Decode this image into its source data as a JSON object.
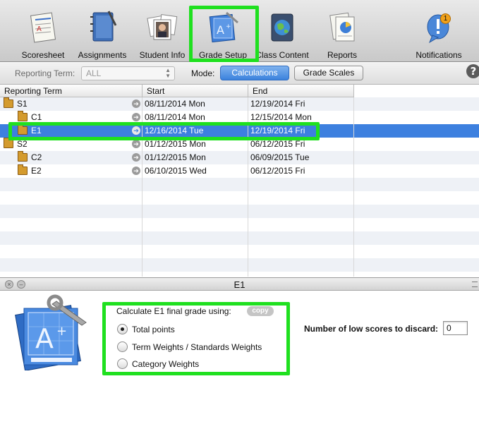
{
  "toolbar": {
    "items": [
      {
        "label": "Scoresheet",
        "icon": "scoresheet-icon"
      },
      {
        "label": "Assignments",
        "icon": "assignments-notebook-icon"
      },
      {
        "label": "Student Info",
        "icon": "student-photos-icon"
      },
      {
        "label": "Grade Setup",
        "icon": "grade-setup-blueprint-icon",
        "highlighted": true
      },
      {
        "label": "Class Content",
        "icon": "globe-icon"
      },
      {
        "label": "Reports",
        "icon": "reports-chart-icon"
      },
      {
        "label": "Notifications",
        "icon": "notifications-icon",
        "badge": "1"
      }
    ]
  },
  "filter": {
    "reporting_term_label": "Reporting Term:",
    "reporting_term_value": "ALL",
    "mode_label": "Mode:",
    "mode_options": [
      "Calculations",
      "Grade Scales"
    ],
    "mode_selected": "Calculations",
    "help": "?"
  },
  "table": {
    "columns": [
      "Reporting Term",
      "Start",
      "End"
    ],
    "rows": [
      {
        "term": "S1",
        "start": "08/11/2014 Mon",
        "end": "12/19/2014 Fri",
        "level": 0
      },
      {
        "term": "C1",
        "start": "08/11/2014 Mon",
        "end": "12/15/2014 Mon",
        "level": 1
      },
      {
        "term": "E1",
        "start": "12/16/2014 Tue",
        "end": "12/19/2014 Fri",
        "level": 1,
        "selected": true
      },
      {
        "term": "S2",
        "start": "01/12/2015 Mon",
        "end": "06/12/2015 Fri",
        "level": 0
      },
      {
        "term": "C2",
        "start": "01/12/2015 Mon",
        "end": "06/09/2015 Tue",
        "level": 1
      },
      {
        "term": "E2",
        "start": "06/10/2015 Wed",
        "end": "06/12/2015 Fri",
        "level": 1
      }
    ]
  },
  "pane": {
    "title": "E1",
    "calc_label": "Calculate E1 final grade using:",
    "copy_label": "copy",
    "options": [
      "Total points",
      "Term Weights / Standards Weights",
      "Category Weights"
    ],
    "selected_option": "Total points",
    "discard_label": "Number of low scores to discard:",
    "discard_value": "0"
  },
  "colors": {
    "highlight": "#1fe01f",
    "selection": "#3d80df",
    "active_segment": "#3b82dd"
  }
}
